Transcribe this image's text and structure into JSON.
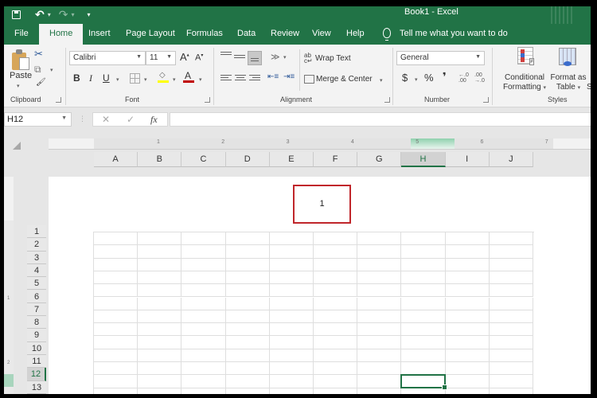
{
  "window": {
    "title": "Book1  -  Excel"
  },
  "qat": {
    "save": "save-icon",
    "undo": "↶",
    "redo": "↷",
    "dropdown": "▾",
    "customize": "▾"
  },
  "tabs": [
    {
      "label": "File"
    },
    {
      "label": "Home",
      "active": true
    },
    {
      "label": "Insert"
    },
    {
      "label": "Page Layout"
    },
    {
      "label": "Formulas"
    },
    {
      "label": "Data"
    },
    {
      "label": "Review"
    },
    {
      "label": "View"
    },
    {
      "label": "Help"
    }
  ],
  "tell_me": "Tell me what you want to do",
  "ribbon": {
    "clipboard": {
      "paste": "Paste",
      "label": "Clipboard",
      "cut": "✂",
      "copy": "⧉",
      "format_painter": "🖌"
    },
    "font": {
      "label": "Font",
      "name": "Calibri",
      "size": "11",
      "grow": "A",
      "shrink": "A",
      "bold": "B",
      "italic": "I",
      "underline": "U",
      "fill_color": "#ffff00",
      "font_color": "#c00000"
    },
    "alignment": {
      "label": "Alignment",
      "wrap_text": "Wrap Text",
      "merge_center": "Merge & Center",
      "wrap_glyph": "ab"
    },
    "number": {
      "label": "Number",
      "format": "General",
      "currency": "$",
      "percent": "%",
      "comma": "❜",
      "inc_decimal": "←.0 .00",
      "dec_decimal": ".00 →.0"
    },
    "styles": {
      "label": "Styles",
      "conditional_1": "Conditional",
      "conditional_2": "Formatting",
      "format_table_1": "Format as",
      "format_table_2": "Table",
      "cell_styles_partial": "S"
    }
  },
  "formula_bar": {
    "name_box": "H12",
    "cancel": "✕",
    "enter": "✓",
    "fx": "fx",
    "value": ""
  },
  "ruler": {
    "marks": [
      "1",
      "2",
      "3",
      "4",
      "5",
      "6",
      "7"
    ],
    "highlighted": "5"
  },
  "columns": [
    "A",
    "B",
    "C",
    "D",
    "E",
    "F",
    "G",
    "H",
    "I",
    "J"
  ],
  "selected_column": "H",
  "rows": [
    "1",
    "2",
    "3",
    "4",
    "5",
    "6",
    "7",
    "8",
    "9",
    "10",
    "11",
    "12",
    "13"
  ],
  "selected_row": "12",
  "vertical_ruler": [
    "1",
    "2"
  ],
  "header_box": {
    "text": "1",
    "highlight_color": "#c0262b"
  },
  "active_cell": "H12",
  "colors": {
    "brand": "#217346",
    "highlight": "#c0262b"
  }
}
